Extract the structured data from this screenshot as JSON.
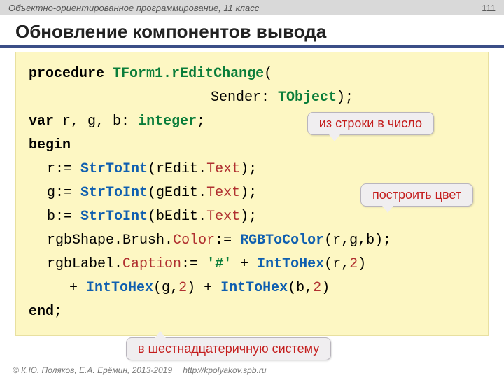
{
  "header": {
    "course": "Объектно-ориентированное программирование, 11 класс",
    "page": "111"
  },
  "title": "Обновление компонентов вывода",
  "code": {
    "kw_procedure": "procedure",
    "class_method": "TForm1.rEditChange",
    "sender": "Sender",
    "tobject": "TObject",
    "kw_var": "var",
    "vars": "r, g, b",
    "integer": "integer",
    "kw_begin": "begin",
    "r_assign": "r:= ",
    "g_assign": "g:= ",
    "b_assign": "b:= ",
    "strtoint": "StrToInt",
    "rEdit": "rEdit",
    "gEdit": "gEdit",
    "bEdit": "bEdit",
    "text": "Text",
    "rgbshape": "rgbShape",
    "brush": "Brush",
    "color": "Color",
    "rgbtocolor": "RGBToColor",
    "args_rgb": "(r,g,b);",
    "rgblabel": "rgbLabel",
    "caption": "Caption",
    "hash": "'#'",
    "inttohex": "IntToHex",
    "r": "r",
    "g": "g",
    "b": "b",
    "two": "2",
    "kw_end": "end"
  },
  "callouts": {
    "c1": "из строки в число",
    "c2": "построить цвет",
    "c3": "в шестнадцатеричную систему"
  },
  "footer": {
    "copyright": "© К.Ю. Поляков, Е.А. Ерёмин, 2013-2019",
    "url": "http://kpolyakov.spb.ru"
  }
}
